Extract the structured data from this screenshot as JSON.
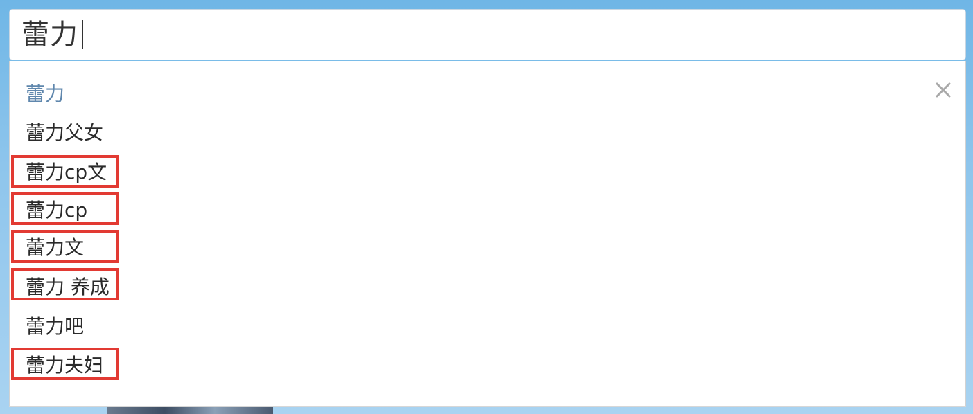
{
  "search": {
    "value": "蕾力"
  },
  "dropdown": {
    "close_icon": "close-icon",
    "suggestions": [
      {
        "label": "蕾力",
        "active": true,
        "highlighted": false
      },
      {
        "label": "蕾力父女",
        "active": false,
        "highlighted": false
      },
      {
        "label": "蕾力cp文",
        "active": false,
        "highlighted": true
      },
      {
        "label": "蕾力cp",
        "active": false,
        "highlighted": true
      },
      {
        "label": "蕾力文",
        "active": false,
        "highlighted": true
      },
      {
        "label": "蕾力 养成",
        "active": false,
        "highlighted": true
      },
      {
        "label": "蕾力吧",
        "active": false,
        "highlighted": false
      },
      {
        "label": "蕾力夫妇",
        "active": false,
        "highlighted": true
      }
    ]
  },
  "colors": {
    "active_suggestion": "#5f87ad",
    "highlight_border": "#e23a33",
    "background_top": "#6fb6e6"
  }
}
